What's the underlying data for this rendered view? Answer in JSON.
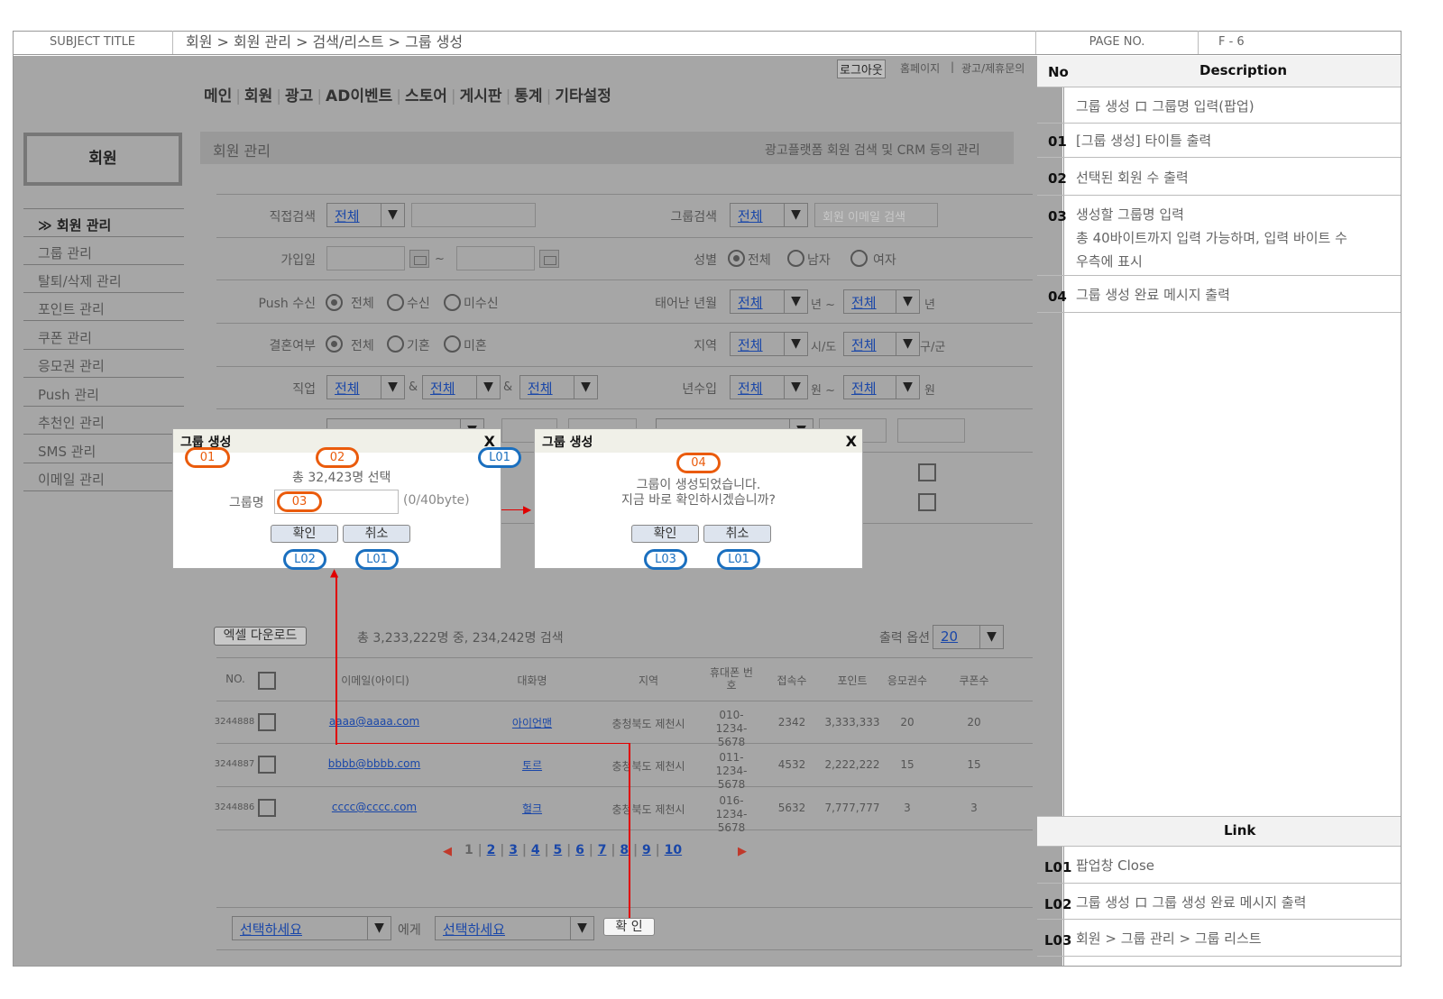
{
  "header": {
    "subject_label": "SUBJECT  TITLE",
    "breadcrumb": "회원 > 회원 관리 > 검색/리스트 > 그룹 생성",
    "page_label": "PAGE  NO.",
    "page_no": "F - 6"
  },
  "topbar": {
    "logout": "로그아웃",
    "home": "홈페이지",
    "sep": "|",
    "ad_inquiry": "광고/제휴문의"
  },
  "nav": [
    "메인",
    "회원",
    "광고",
    "AD이벤트",
    "스토어",
    "게시판",
    "통계",
    "기타설정"
  ],
  "sidebar": {
    "title": "회원",
    "items": [
      "≫ 회원 관리",
      "그룹 관리",
      "탈퇴/삭제 관리",
      "포인트 관리",
      "쿠폰 관리",
      "응모권 관리",
      "Push 관리",
      "추천인 관리",
      "SMS 관리",
      "이메일 관리"
    ]
  },
  "section": {
    "title": "회원 관리",
    "desc": "광고플랫폼 회원 검색 및 CRM 등의 관리"
  },
  "form": {
    "direct_search": "직접검색",
    "all": "전체",
    "group_search": "그룹검색",
    "email_placeholder": "회원 이메일 검색",
    "join_date": "가입일",
    "tilde": "~",
    "gender": "성별",
    "gender_opts": [
      "전체",
      "남자",
      "여자"
    ],
    "push": "Push 수신",
    "push_opts": [
      "전체",
      "수신",
      "미수신"
    ],
    "birth": "태어난 년월",
    "year": "년 ~",
    "year2": "년",
    "married": "결혼여부",
    "married_opts": [
      "전체",
      "기혼",
      "미혼"
    ],
    "region": "지역",
    "sido": "시/도",
    "gugun": "구/군",
    "job": "직업",
    "amp": "&",
    "income": "년수입",
    "won_tilde": "원 ~",
    "won": "원",
    "down": "▼"
  },
  "list": {
    "excel": "엑셀 다운로드",
    "summary": "총 3,233,222명 중, 234,242명 검색",
    "output_opt": "출력 옵션",
    "output_val": "20",
    "headers": [
      "NO.",
      "이메일(아이디)",
      "대화명",
      "지역",
      "휴대폰 번호",
      "접속수",
      "포인트",
      "응모권수",
      "쿠폰수"
    ],
    "rows": [
      {
        "no": "3244888",
        "email": "aaaa@aaaa.com",
        "nick": "아이언맨",
        "region": "충청북도 제천시",
        "phone": "010-1234-5678",
        "visits": "2342",
        "points": "3,333,333",
        "entries": "20",
        "coupons": "20"
      },
      {
        "no": "3244887",
        "email": "bbbb@bbbb.com",
        "nick": "토르",
        "region": "충청북도 제천시",
        "phone": "011-1234-5678",
        "visits": "4532",
        "points": "2,222,222",
        "entries": "15",
        "coupons": "15"
      },
      {
        "no": "3244886",
        "email": "cccc@cccc.com",
        "nick": "헐크",
        "region": "충청북도 제천시",
        "phone": "016-1234-5678",
        "visits": "5632",
        "points": "7,777,777",
        "entries": "3",
        "coupons": "3"
      }
    ],
    "pages": [
      "1",
      "2",
      "3",
      "4",
      "5",
      "6",
      "7",
      "8",
      "9",
      "10"
    ],
    "prev": "◀",
    "next": "▶",
    "select1": "선택하세요",
    "to": "에게",
    "select2": "선택하세요",
    "confirm": "확 인"
  },
  "dialog1": {
    "title": "그룹 생성",
    "close": "X",
    "count": "총 32,423명 선택",
    "group_label": "그룹명",
    "bytes": "(0/40byte)",
    "ok": "확인",
    "cancel": "취소"
  },
  "dialog2": {
    "title": "그룹 생성",
    "close": "X",
    "msg1": "그룹이 생성되었습니다.",
    "msg2": "지금 바로 확인하시겠습니까?",
    "ok": "확인",
    "cancel": "취소"
  },
  "badges": {
    "b01": "01",
    "b02": "02",
    "b03": "03",
    "b04": "04",
    "l01": "L01",
    "l02": "L02",
    "l03": "L03"
  },
  "desc_panel": {
    "no": "No",
    "description": "Description",
    "rows": [
      {
        "n": "",
        "d": "그룹 생성 ロ 그룹명 입력(팝업)"
      },
      {
        "n": "01",
        "d": "[그룹 생성] 타이틀 출력"
      },
      {
        "n": "02",
        "d": "선택된 회원 수 출력"
      },
      {
        "n": "03",
        "d": "생성할 그룹명 입력",
        "d2": "총 40바이트까지 입력 가능하며, 입력 바이트 수",
        "d3": "우측에 표시"
      },
      {
        "n": "04",
        "d": "그룹 생성 완료 메시지 출력"
      }
    ],
    "link_title": "Link",
    "links": [
      {
        "n": "L01",
        "d": "팝업창 Close"
      },
      {
        "n": "L02",
        "d": "그룹 생성 ロ 그룹 생성 완료 메시지 출력"
      },
      {
        "n": "L03",
        "d": "회원 > 그룹 관리 > 그룹 리스트"
      }
    ]
  },
  "colors": {
    "bg_gray": "#a6a6a6",
    "orange": "#ea5b0c",
    "blue": "#1a6fbf",
    "red": "#e00000"
  }
}
